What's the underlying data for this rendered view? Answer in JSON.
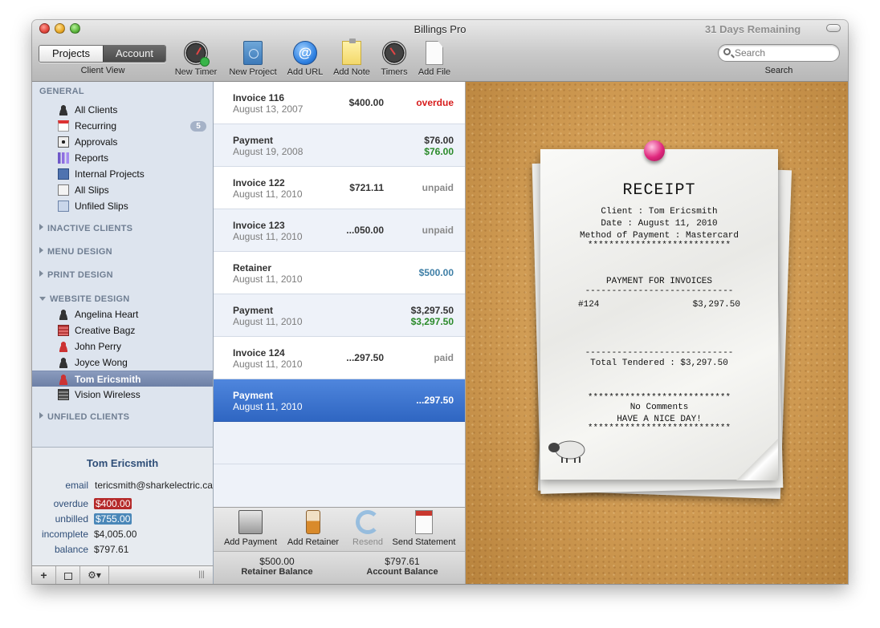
{
  "window": {
    "title": "Billings Pro",
    "trial_notice": "31 Days Remaining"
  },
  "toolbar": {
    "segments": [
      "Projects",
      "Account"
    ],
    "segment_caption": "Client View",
    "buttons": [
      {
        "label": "New Timer",
        "icon": "stopwatch-play-icon"
      },
      {
        "label": "New Project",
        "icon": "project-notebook-icon"
      },
      {
        "label": "Add URL",
        "icon": "at-sign-icon"
      },
      {
        "label": "Add Note",
        "icon": "sticky-note-icon"
      },
      {
        "label": "Timers",
        "icon": "stopwatch-icon"
      },
      {
        "label": "Add File",
        "icon": "document-icon"
      }
    ],
    "search": {
      "placeholder": "Search",
      "caption": "Search"
    }
  },
  "sidebar": {
    "general_header": "GENERAL",
    "general_items": [
      {
        "label": "All Clients",
        "icon": "person-icon"
      },
      {
        "label": "Recurring",
        "icon": "calendar-icon",
        "badge": "5"
      },
      {
        "label": "Approvals",
        "icon": "eye-icon"
      },
      {
        "label": "Reports",
        "icon": "bar-chart-icon"
      },
      {
        "label": "Internal Projects",
        "icon": "internal-projects-icon"
      },
      {
        "label": "All Slips",
        "icon": "slips-icon"
      },
      {
        "label": "Unfiled Slips",
        "icon": "unfiled-icon"
      }
    ],
    "collapsed_groups": [
      "INACTIVE CLIENTS",
      "MENU DESIGN",
      "PRINT DESIGN"
    ],
    "website_header": "WEBSITE DESIGN",
    "website_items": [
      {
        "label": "Angelina Heart",
        "icon": "person-icon"
      },
      {
        "label": "Creative Bagz",
        "icon": "building-icon"
      },
      {
        "label": "John Perry",
        "icon": "person-icon"
      },
      {
        "label": "Joyce Wong",
        "icon": "person-icon"
      },
      {
        "label": "Tom Ericsmith",
        "icon": "person-icon",
        "selected": true
      },
      {
        "label": "Vision Wireless",
        "icon": "building-icon"
      }
    ],
    "unfiled_header": "UNFILED CLIENTS"
  },
  "client_info": {
    "name": "Tom Ericsmith",
    "email_label": "email",
    "email": "tericsmith@sharkelectric.ca",
    "overdue_label": "overdue",
    "overdue": "$400.00",
    "unbilled_label": "unbilled",
    "unbilled": "$755.00",
    "incomplete_label": "incomplete",
    "incomplete": "$4,005.00",
    "balance_label": "balance",
    "balance": "$797.61"
  },
  "footer_buttons": {
    "add": "+",
    "gear": "⚙▾",
    "grip": "|||"
  },
  "list": {
    "rows": [
      {
        "title": "Invoice 116",
        "date": "August 13, 2007",
        "amount": "$400.00",
        "status": "overdue"
      },
      {
        "title": "Payment",
        "date": "August 19, 2008",
        "amount": "$76.00",
        "applied": "$76.00"
      },
      {
        "title": "Invoice 122",
        "date": "August 11, 2010",
        "amount": "$721.11",
        "status": "unpaid"
      },
      {
        "title": "Invoice 123",
        "date": "August 11, 2010",
        "amount": "...050.00",
        "status": "unpaid"
      },
      {
        "title": "Retainer",
        "date": "August 11, 2010",
        "amount": "$500.00"
      },
      {
        "title": "Payment",
        "date": "August 11, 2010",
        "amount": "$3,297.50",
        "applied": "$3,297.50"
      },
      {
        "title": "Invoice 124",
        "date": "August 11, 2010",
        "amount": "...297.50",
        "status": "paid"
      },
      {
        "title": "Payment",
        "date": "August 11, 2010",
        "amount": "...297.50"
      }
    ]
  },
  "list_actions": [
    {
      "label": "Add Payment",
      "icon": "cash-register-icon"
    },
    {
      "label": "Add Retainer",
      "icon": "jar-icon"
    },
    {
      "label": "Resend",
      "icon": "resend-icon",
      "disabled": true
    },
    {
      "label": "Send Statement",
      "icon": "statement-icon"
    }
  ],
  "balances": {
    "retainer_value": "$500.00",
    "retainer_label": "Retainer Balance",
    "account_value": "$797.61",
    "account_label": "Account Balance"
  },
  "receipt": {
    "title": "RECEIPT",
    "client_line": "Client : Tom Ericsmith",
    "date_line": "Date : August 11, 2010",
    "method_line": "Method of Payment : Mastercard",
    "stars": "***************************",
    "section_title": "PAYMENT FOR INVOICES",
    "dashes": "----------------------------",
    "invoice_no": "#124",
    "invoice_amount": "$3,297.50",
    "total_line": "Total Tendered : $3,297.50",
    "comments": "No Comments",
    "goodbye": "HAVE A NICE DAY!"
  },
  "colors": {
    "overdue": "#d71d1d",
    "paid_green": "#2a8a2a",
    "selection_blue": "#3a72cf",
    "sidebar_bg": "#dde4ee"
  }
}
